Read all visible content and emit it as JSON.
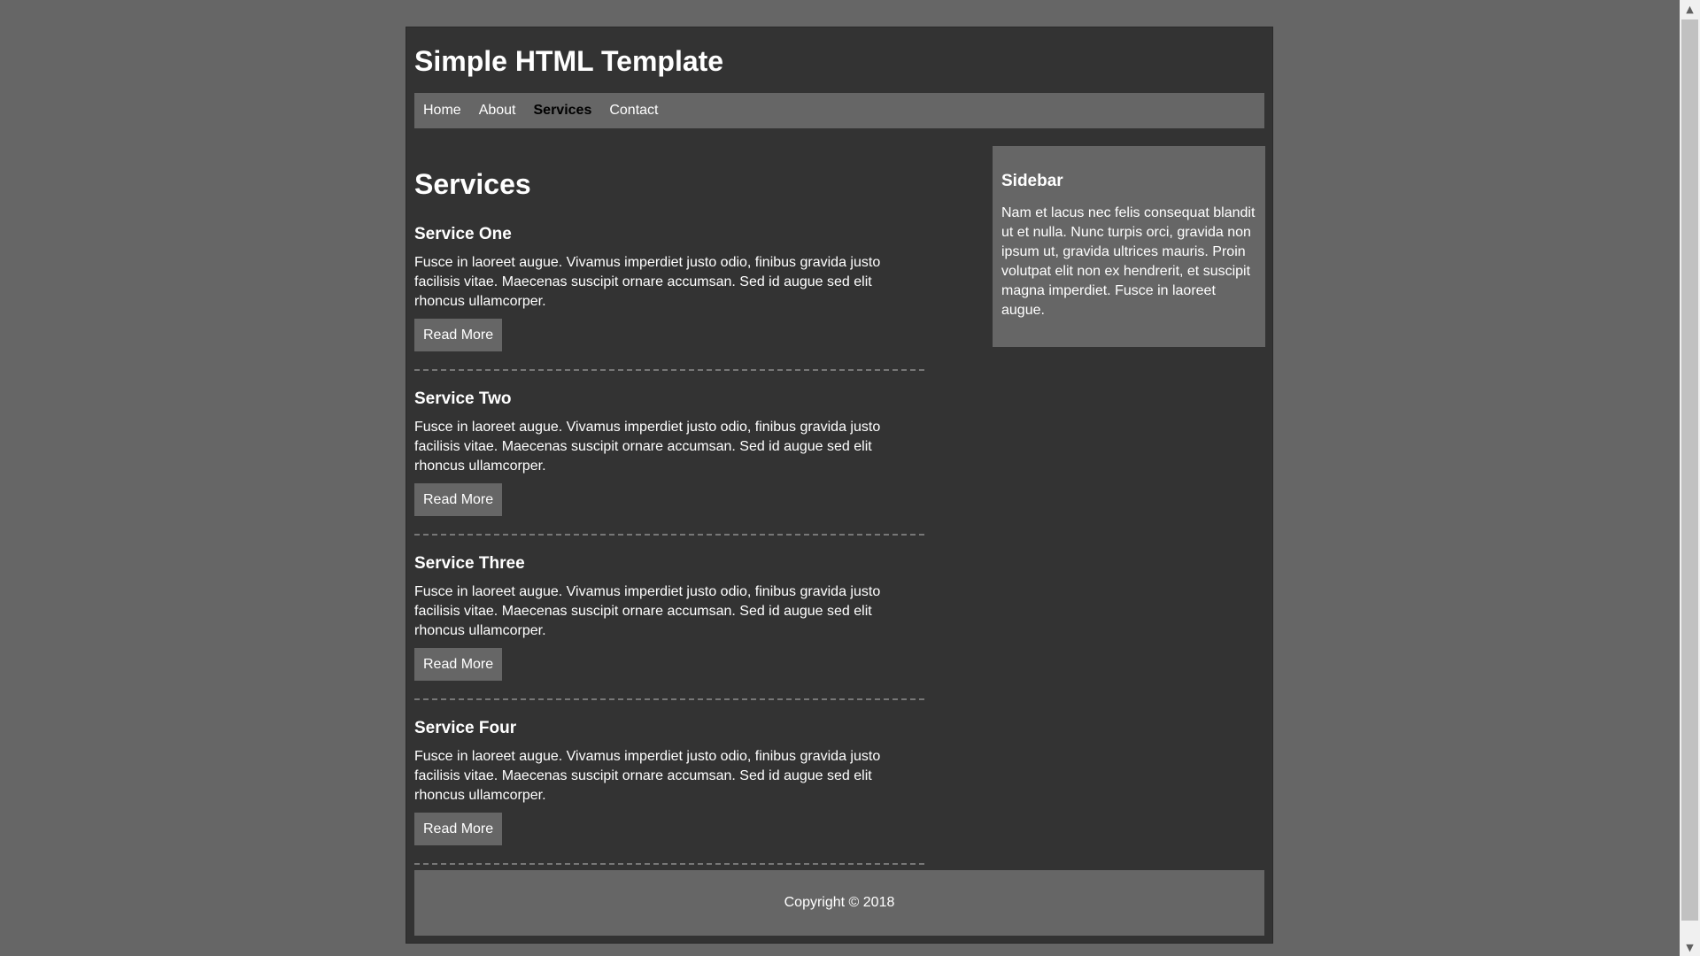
{
  "header": {
    "title": "Simple HTML Template"
  },
  "nav": {
    "items": [
      {
        "label": "Home",
        "active": false
      },
      {
        "label": "About",
        "active": false
      },
      {
        "label": "Services",
        "active": true
      },
      {
        "label": "Contact",
        "active": false
      }
    ]
  },
  "main": {
    "heading": "Services",
    "services": [
      {
        "title": "Service One",
        "text": "Fusce in laoreet augue. Vivamus imperdiet justo odio, finibus gravida justo facilisis vitae. Maecenas suscipit ornare accumsan. Sed id augue sed elit rhoncus ullamcorper.",
        "button": "Read More"
      },
      {
        "title": "Service Two",
        "text": "Fusce in laoreet augue. Vivamus imperdiet justo odio, finibus gravida justo facilisis vitae. Maecenas suscipit ornare accumsan. Sed id augue sed elit rhoncus ullamcorper.",
        "button": "Read More"
      },
      {
        "title": "Service Three",
        "text": "Fusce in laoreet augue. Vivamus imperdiet justo odio, finibus gravida justo facilisis vitae. Maecenas suscipit ornare accumsan. Sed id augue sed elit rhoncus ullamcorper.",
        "button": "Read More"
      },
      {
        "title": "Service Four",
        "text": "Fusce in laoreet augue. Vivamus imperdiet justo odio, finibus gravida justo facilisis vitae. Maecenas suscipit ornare accumsan. Sed id augue sed elit rhoncus ullamcorper.",
        "button": "Read More"
      }
    ]
  },
  "sidebar": {
    "title": "Sidebar",
    "text": "Nam et lacus nec felis consequat blandit ut et nulla. Nunc turpis orci, gravida non ipsum ut, gravida ultrices mauris. Proin volutpat elit non ex hendrerit, et suscipit magna imperdiet. Fusce in laoreet augue."
  },
  "footer": {
    "text": "Copyright © 2018"
  },
  "scrollbar": {
    "up_icon": "▲",
    "down_icon": "▼"
  },
  "colors": {
    "page_background": "#666666",
    "container_background": "#333333",
    "panel_background": "#666666",
    "text": "#ffffff",
    "active_nav_text": "#000000"
  }
}
